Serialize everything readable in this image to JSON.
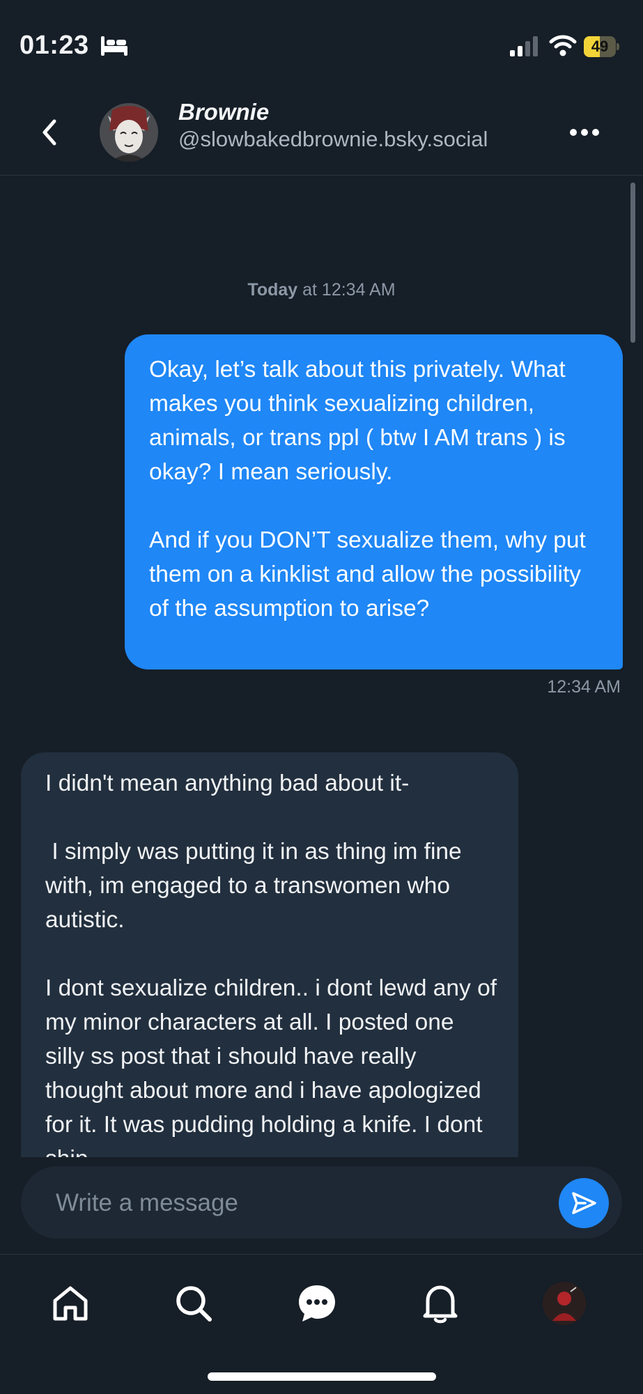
{
  "status_bar": {
    "time": "01:23",
    "battery_level": "49",
    "battery_fraction": 0.49
  },
  "header": {
    "name": "Brownie",
    "handle": "@slowbakedbrownie.bsky.social"
  },
  "conversation": {
    "date_separator": {
      "day": "Today",
      "rest": " at 12:34 AM"
    },
    "messages": [
      {
        "direction": "outgoing",
        "paragraphs": [
          "Okay, let’s talk about this privately. What makes you think sexualizing children, animals, or trans ppl ( btw I AM trans ) is okay? I mean seriously.",
          "And if you DON’T sexualize them, why put them on a kinklist and allow the possibility of the assumption to arise?"
        ],
        "time": "12:34 AM"
      },
      {
        "direction": "incoming",
        "paragraphs": [
          "I didn't mean anything bad about it-",
          " I simply was putting it in as thing im fine with, im engaged to a transwomen who autistic.",
          "I dont sexualize children.. i dont lewd any of my minor characters at all. I posted one silly ss post that i should have really thought about more and i have apologized for it. It was pudding holding a knife. I dont ship"
        ]
      }
    ]
  },
  "composer": {
    "placeholder": "Write a message"
  },
  "colors": {
    "accent": "#1f87f6",
    "background": "#161e27",
    "incoming_bubble": "#222f3e"
  },
  "bottom_nav": {
    "items": [
      "home-icon",
      "search-icon",
      "chat-icon",
      "bell-icon",
      "profile-avatar"
    ]
  }
}
